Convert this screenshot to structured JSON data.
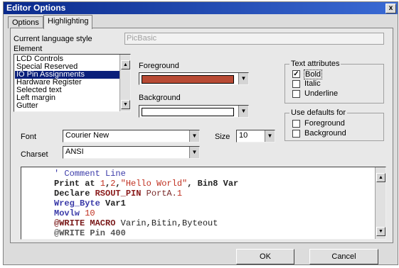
{
  "window": {
    "title": "Editor Options",
    "close_label": "x"
  },
  "tabs": [
    {
      "label": "Options"
    },
    {
      "label": "Highlighting"
    }
  ],
  "language_style": {
    "label": "Current language style",
    "value": "PicBasic"
  },
  "element": {
    "label": "Element",
    "items": [
      "LCD Controls",
      "Special Reserved",
      "IO Pin Assignments",
      "Hardware Register",
      "Selected text",
      "Left margin",
      "Gutter"
    ],
    "selected_index": 2
  },
  "foreground": {
    "label": "Foreground",
    "color": "#b84a34"
  },
  "background": {
    "label": "Background",
    "color": "#ffffff"
  },
  "text_attributes": {
    "title": "Text attributes",
    "bold": {
      "label": "Bold",
      "checked": true
    },
    "italic": {
      "label": "Italic",
      "checked": false
    },
    "underline": {
      "label": "Underline",
      "checked": false
    }
  },
  "use_defaults": {
    "title": "Use defaults for",
    "foreground": {
      "label": "Foreground",
      "checked": false
    },
    "background": {
      "label": "Background",
      "checked": false
    }
  },
  "font": {
    "label": "Font",
    "value": "Courier New"
  },
  "size": {
    "label": "Size",
    "value": "10"
  },
  "charset": {
    "label": "Charset",
    "value": "ANSI"
  },
  "preview": {
    "lines": [
      [
        {
          "t": "' Comment Line",
          "c": "#3a3aa8",
          "b": false
        }
      ],
      [
        {
          "t": "Print at ",
          "c": "#222222",
          "b": true
        },
        {
          "t": "1",
          "c": "#c03020",
          "b": false
        },
        {
          "t": ",",
          "c": "#222222",
          "b": true
        },
        {
          "t": "2",
          "c": "#c03020",
          "b": false
        },
        {
          "t": ",",
          "c": "#222222",
          "b": true
        },
        {
          "t": "\"Hello World\"",
          "c": "#c03020",
          "b": false
        },
        {
          "t": ", Bin8 Var",
          "c": "#222222",
          "b": true
        }
      ],
      [
        {
          "t": "Declare ",
          "c": "#222222",
          "b": true
        },
        {
          "t": "RSOUT_PIN",
          "c": "#8a1a1a",
          "b": true
        },
        {
          "t": " PortA.",
          "c": "#7a2a2a",
          "b": false
        },
        {
          "t": "1",
          "c": "#c03020",
          "b": false
        }
      ],
      [
        {
          "t": "Wreg_Byte",
          "c": "#3a3aa8",
          "b": true
        },
        {
          "t": " Var1",
          "c": "#222222",
          "b": true
        }
      ],
      [
        {
          "t": "Movlw",
          "c": "#3a3aa8",
          "b": true
        },
        {
          "t": " 10",
          "c": "#c03020",
          "b": false
        }
      ],
      [
        {
          "t": "@WRITE MACRO",
          "c": "#7a1a1a",
          "b": true
        },
        {
          "t": " Varin,Bitin,Byteout",
          "c": "#222222",
          "b": false
        }
      ],
      [
        {
          "t": "@WRITE Pin 400",
          "c": "#555555",
          "b": true
        }
      ]
    ]
  },
  "buttons": {
    "ok": "OK",
    "cancel": "Cancel"
  },
  "icons": {
    "scroll_up": "▲",
    "scroll_down": "▼",
    "dropdown": "▼"
  }
}
